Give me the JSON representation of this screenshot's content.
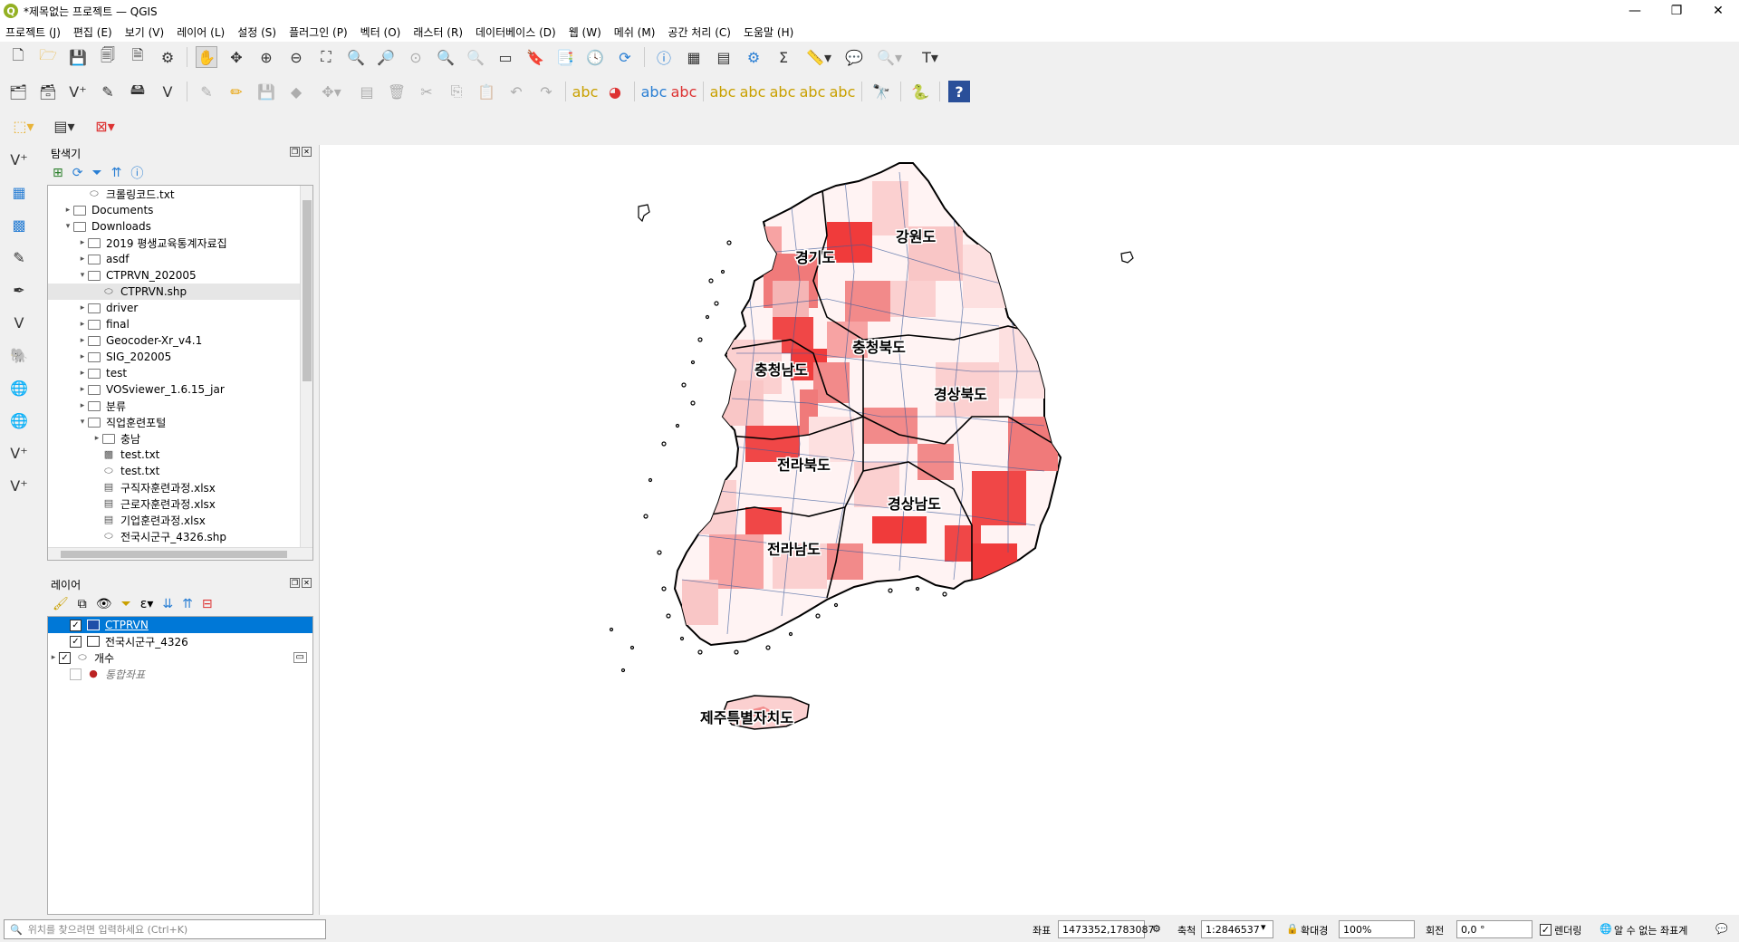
{
  "window": {
    "title": "*제목없는 프로젝트 — QGIS",
    "minimize": "—",
    "restore": "❐",
    "close": "✕"
  },
  "menu": [
    "프로젝트 (J)",
    "편집 (E)",
    "보기 (V)",
    "레이어 (L)",
    "설정 (S)",
    "플러그인 (P)",
    "벡터 (O)",
    "래스터 (R)",
    "데이터베이스 (D)",
    "웹 (W)",
    "메쉬 (M)",
    "공간 처리 (C)",
    "도움말 (H)"
  ],
  "browser": {
    "title": "탐색기",
    "items": [
      {
        "label": "크롤링코드.txt",
        "indent": 3,
        "icon": "file"
      },
      {
        "label": "Documents",
        "indent": 2,
        "icon": "folder",
        "arrow": "▸"
      },
      {
        "label": "Downloads",
        "indent": 2,
        "icon": "folder",
        "arrow": "▾"
      },
      {
        "label": "2019 평생교육통계자료집",
        "indent": 3,
        "icon": "folder",
        "arrow": "▸"
      },
      {
        "label": "asdf",
        "indent": 3,
        "icon": "folder",
        "arrow": "▸"
      },
      {
        "label": "CTPRVN_202005",
        "indent": 3,
        "icon": "folder",
        "arrow": "▾"
      },
      {
        "label": "CTPRVN.shp",
        "indent": 4,
        "icon": "shape",
        "selected": true
      },
      {
        "label": "driver",
        "indent": 3,
        "icon": "folder",
        "arrow": "▸"
      },
      {
        "label": "final",
        "indent": 3,
        "icon": "folder",
        "arrow": "▸"
      },
      {
        "label": "Geocoder-Xr_v4.1",
        "indent": 3,
        "icon": "folder",
        "arrow": "▸"
      },
      {
        "label": "SIG_202005",
        "indent": 3,
        "icon": "folder",
        "arrow": "▸"
      },
      {
        "label": "test",
        "indent": 3,
        "icon": "folder",
        "arrow": "▸"
      },
      {
        "label": "VOSviewer_1.6.15_jar",
        "indent": 3,
        "icon": "folder",
        "arrow": "▸"
      },
      {
        "label": "분류",
        "indent": 3,
        "icon": "folder",
        "arrow": "▸"
      },
      {
        "label": "직업훈련포털",
        "indent": 3,
        "icon": "folder",
        "arrow": "▾"
      },
      {
        "label": "충남",
        "indent": 4,
        "icon": "folder",
        "arrow": "▸"
      },
      {
        "label": "test.txt",
        "indent": 4,
        "icon": "raster"
      },
      {
        "label": "test.txt",
        "indent": 4,
        "icon": "shape"
      },
      {
        "label": "구직자훈련과정.xlsx",
        "indent": 4,
        "icon": "table"
      },
      {
        "label": "근로자훈련과정.xlsx",
        "indent": 4,
        "icon": "table"
      },
      {
        "label": "기업훈련과정.xlsx",
        "indent": 4,
        "icon": "table"
      },
      {
        "label": "전국시군구_4326.shp",
        "indent": 4,
        "icon": "shape"
      }
    ]
  },
  "layers": {
    "title": "레이어",
    "items": [
      {
        "label": "CTPRVN",
        "checked": true,
        "selected": true,
        "swatch": "#1f4fa8"
      },
      {
        "label": "전국시군구_4326",
        "checked": true,
        "swatch": "#ffffff"
      },
      {
        "label": "개수",
        "checked": true,
        "group": true
      },
      {
        "label": "통합좌표",
        "checked": false,
        "point": true
      }
    ]
  },
  "map": {
    "labels": [
      "경기도",
      "강원도",
      "충청북도",
      "충청남도",
      "경상북도",
      "전라북도",
      "경상남도",
      "전라남도",
      "제주특별자치도"
    ]
  },
  "status": {
    "locator_placeholder": "위치를 찾으려면 입력하세요 (Ctrl+K)",
    "coord_label": "좌표",
    "coord_value": "1473352,1783087",
    "scale_label": "축척",
    "scale_value": "1:2846537",
    "magnifier_label": "확대경",
    "magnifier_value": "100%",
    "rotation_label": "회전",
    "rotation_value": "0,0 °",
    "render_label": "렌더링",
    "crs_label": "알 수 없는 좌표계"
  },
  "colors": {
    "selection": "#0078d7",
    "choropleth_high": "#f03b3b",
    "choropleth_low": "#fde0e0"
  }
}
